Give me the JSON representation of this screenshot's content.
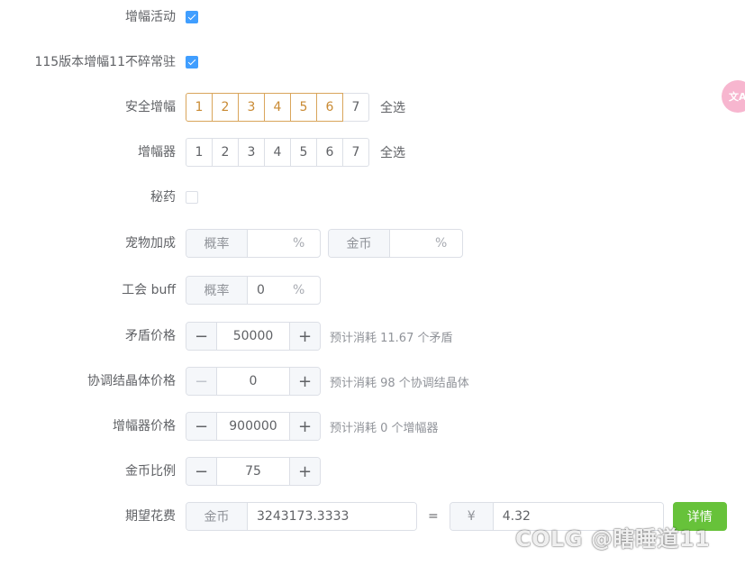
{
  "form": {
    "boost_activity": {
      "label": "增幅活动",
      "checked": true
    },
    "v115_boost": {
      "label": "115版本增幅11不碎常驻",
      "checked": true
    },
    "safe_boost": {
      "label": "安全增幅",
      "levels": [
        "1",
        "2",
        "3",
        "4",
        "5",
        "6",
        "7"
      ],
      "selected": [
        "1",
        "2",
        "3",
        "4",
        "5",
        "6"
      ],
      "select_all": "全选"
    },
    "booster": {
      "label": "增幅器",
      "levels": [
        "1",
        "2",
        "3",
        "4",
        "5",
        "6",
        "7"
      ],
      "selected": [],
      "select_all": "全选"
    },
    "potion": {
      "label": "秘药",
      "checked": false
    },
    "pet_bonus": {
      "label": "宠物加成",
      "rate_prefix": "概率",
      "rate_value": "",
      "rate_suffix": "%",
      "gold_prefix": "金币",
      "gold_value": "",
      "gold_suffix": "%"
    },
    "guild_buff": {
      "label": "工会 buff",
      "rate_prefix": "概率",
      "rate_value": "0",
      "rate_suffix": "%"
    },
    "shield_price": {
      "label": "矛盾价格",
      "value": "50000",
      "hint": "预计消耗 11.67 个矛盾"
    },
    "crystal_price": {
      "label": "协调结晶体价格",
      "value": "0",
      "hint": "预计消耗 98 个协调结晶体"
    },
    "booster_price": {
      "label": "增幅器价格",
      "value": "900000",
      "hint": "预计消耗 0 个增幅器"
    },
    "gold_ratio": {
      "label": "金币比例",
      "value": "75"
    },
    "expected_cost": {
      "label": "期望花费",
      "gold_prefix": "金币",
      "gold_value": "3243173.3333",
      "equals": "=",
      "yuan_prefix": "¥",
      "yuan_value": "4.32",
      "detail_button": "详情"
    }
  },
  "icons": {
    "minus": "−",
    "plus": "+"
  },
  "overlay": {
    "badge_text": "文A",
    "watermark": "COLG @瞎睡道11"
  },
  "colors": {
    "accent": "#409eff",
    "selected_level": "#d9a55b",
    "detail_button": "#67c23a"
  }
}
